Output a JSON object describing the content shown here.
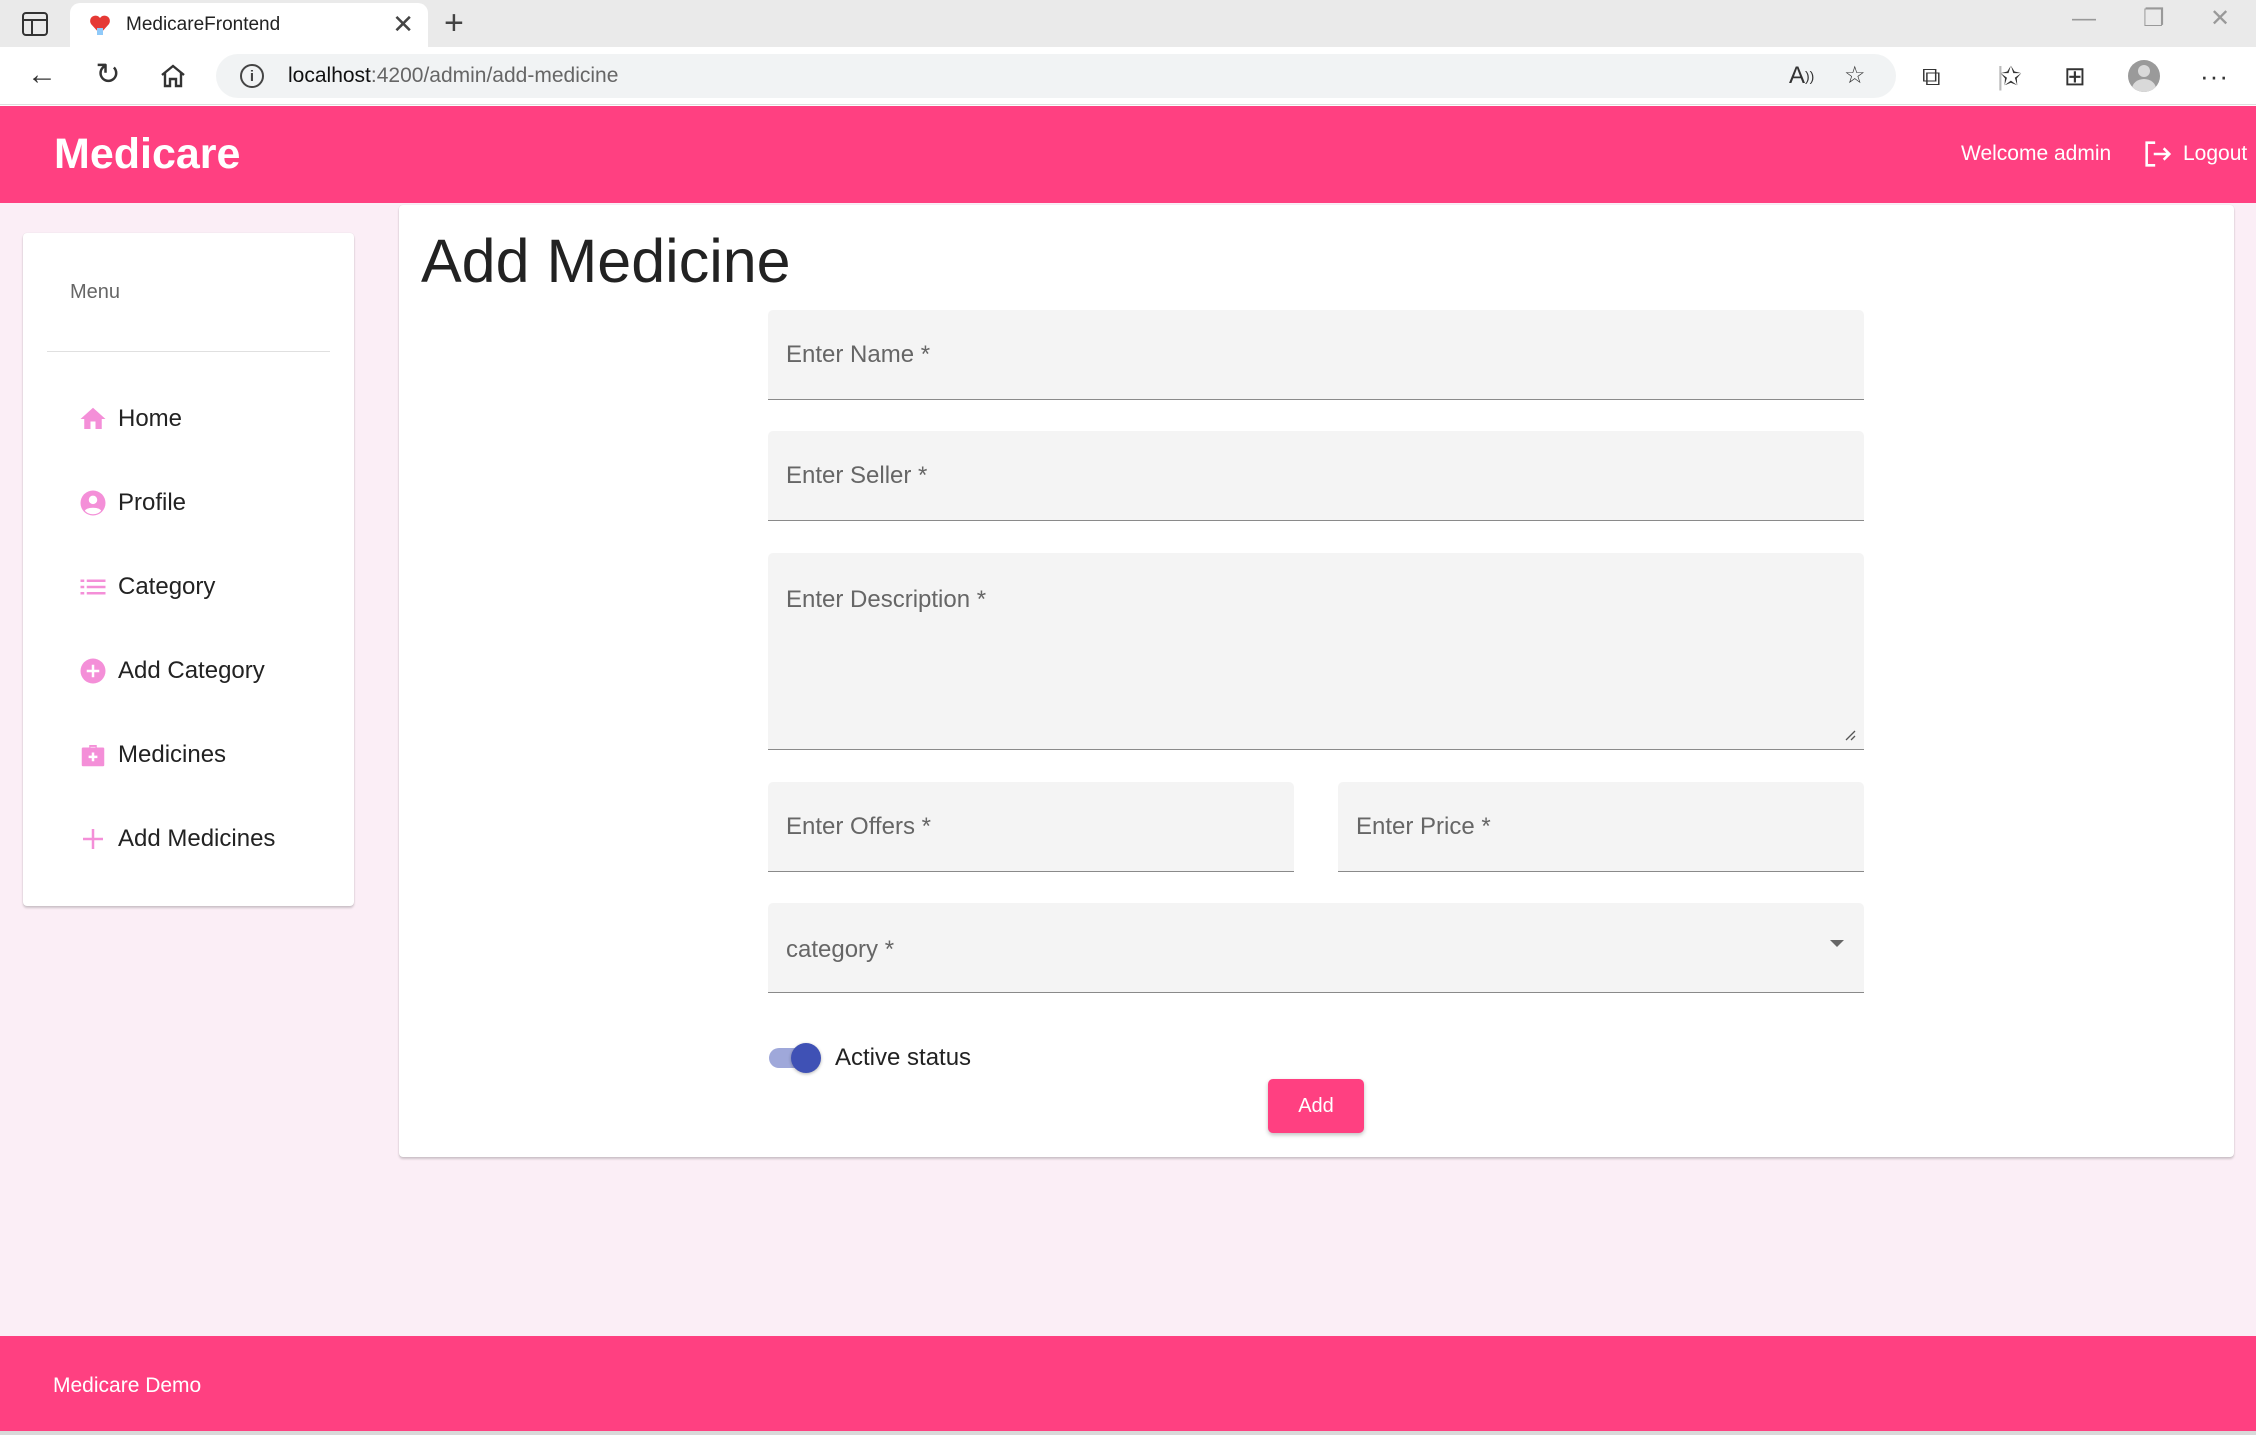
{
  "browser": {
    "tab_title": "MedicareFrontend",
    "url_host": "localhost",
    "url_path": ":4200/admin/add-medicine",
    "icons": [
      "sidebar-toggle-icon",
      "favicon-icon",
      "close-icon",
      "new-tab-icon",
      "minimize-icon",
      "restore-icon",
      "window-close-icon",
      "back-icon",
      "refresh-icon",
      "home-icon",
      "info-icon",
      "read-aloud-icon",
      "favorite-add-icon",
      "extensions-icon",
      "favorites-icon",
      "collections-icon",
      "profile-icon",
      "more-icon"
    ]
  },
  "header": {
    "brand": "Medicare",
    "welcome": "Welcome admin",
    "logout": "Logout"
  },
  "sidebar": {
    "menu_label": "Menu",
    "items": [
      {
        "label": "Home",
        "icon": "home-icon"
      },
      {
        "label": "Profile",
        "icon": "account-circle-icon"
      },
      {
        "label": "Category",
        "icon": "list-icon"
      },
      {
        "label": "Add Category",
        "icon": "add-circle-icon"
      },
      {
        "label": "Medicines",
        "icon": "medical-bag-icon"
      },
      {
        "label": "Add Medicines",
        "icon": "plus-icon"
      }
    ]
  },
  "form": {
    "title": "Add Medicine",
    "name_label": "Enter Name *",
    "name_value": "",
    "seller_label": "Enter Seller *",
    "seller_value": "",
    "description_label": "Enter Description *",
    "description_value": "",
    "offers_label": "Enter Offers *",
    "offers_value": "",
    "price_label": "Enter Price *",
    "price_value": "",
    "category_label": "category *",
    "category_value": "",
    "active_label": "Active status",
    "active_checked": true,
    "submit_label": "Add"
  },
  "footer": {
    "text": "Medicare Demo"
  },
  "colors": {
    "accent": "#ff4081",
    "toggle_primary": "#3f51b5",
    "icon_pink": "#f48fd8",
    "background": "#fbeef6"
  }
}
